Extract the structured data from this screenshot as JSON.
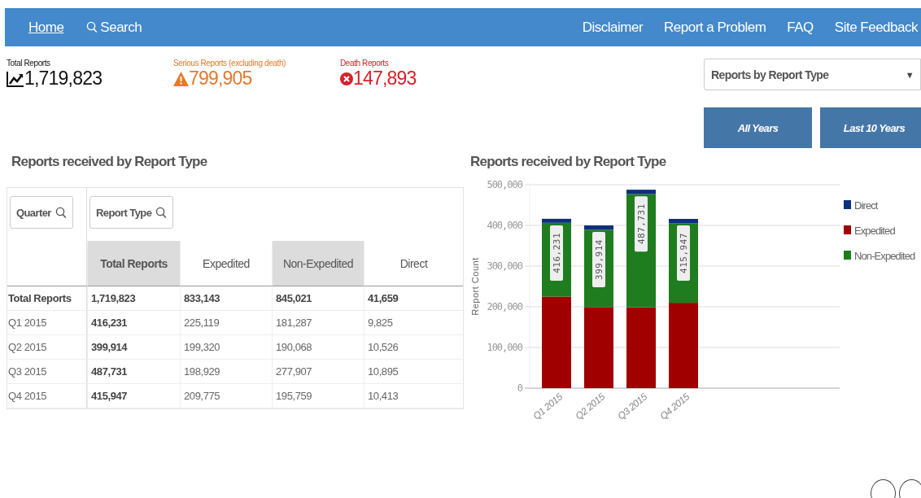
{
  "nav": {
    "left": [
      {
        "label": "Home",
        "kind": "link",
        "selected": true
      },
      {
        "label": "Search",
        "kind": "search",
        "selected": false
      }
    ],
    "right": [
      "Disclaimer",
      "Report a Problem",
      "FAQ",
      "Site Feedback"
    ]
  },
  "stats": [
    {
      "label": "Total Reports",
      "value": "1,719,823",
      "kind": "trend"
    },
    {
      "label": "Serious Reports (excluding death)",
      "value": "799,905",
      "kind": "warning"
    },
    {
      "label": "Death Reports",
      "value": "147,893",
      "kind": "death"
    }
  ],
  "report_select": {
    "value": "Reports by Report Type",
    "caret": "▼"
  },
  "year_buttons": [
    "All Years",
    "Last 10 Years"
  ],
  "table_section": {
    "title": "Reports received by Report Type",
    "filters": [
      "Quarter",
      "Report Type"
    ],
    "columns": [
      {
        "label": "Total Reports",
        "shaded": true
      },
      {
        "label": "Expedited",
        "shaded": false
      },
      {
        "label": "Non-Expedited",
        "shaded": true
      },
      {
        "label": "Direct",
        "shaded": false
      }
    ],
    "rows": [
      {
        "label": "Total Reports",
        "total": true,
        "cells": [
          "1,719,823",
          "833,143",
          "845,021",
          "41,659"
        ]
      },
      {
        "label": "Q1 2015",
        "total": false,
        "cells": [
          "416,231",
          "225,119",
          "181,287",
          "9,825"
        ]
      },
      {
        "label": "Q2 2015",
        "total": false,
        "cells": [
          "399,914",
          "199,320",
          "190,068",
          "10,526"
        ]
      },
      {
        "label": "Q3 2015",
        "total": false,
        "cells": [
          "487,731",
          "198,929",
          "277,907",
          "10,895"
        ]
      },
      {
        "label": "Q4 2015",
        "total": false,
        "cells": [
          "415,947",
          "209,775",
          "195,759",
          "10,413"
        ]
      }
    ]
  },
  "chart_section": {
    "title": "Reports received by Report Type",
    "chart_data": {
      "type": "bar",
      "stacked": true,
      "orientation": "vertical",
      "ylabel": "Report Count",
      "categories": [
        "Q1 2015",
        "Q2 2015",
        "Q3 2015",
        "Q4 2015"
      ],
      "series": [
        {
          "name": "Direct",
          "color": "#0d2f7f",
          "values": [
            9825,
            10526,
            10895,
            10413
          ]
        },
        {
          "name": "Expedited",
          "color": "#a00000",
          "values": [
            225119,
            199320,
            198929,
            209775
          ]
        },
        {
          "name": "Non-Expedited",
          "color": "#1f7d1f",
          "values": [
            181287,
            190068,
            277907,
            195759
          ]
        }
      ],
      "legend": true,
      "grid": true,
      "ylim": [
        0,
        500000
      ],
      "yticks": [
        {
          "value": 0,
          "label": "0"
        },
        {
          "value": 100000,
          "label": "100,000"
        },
        {
          "value": 200000,
          "label": "200,000"
        },
        {
          "value": 300000,
          "label": "300,000"
        },
        {
          "value": 400000,
          "label": "400,000"
        },
        {
          "value": 500000,
          "label": "500,000"
        }
      ],
      "value_labels": [
        "416,231",
        "399,914",
        "487,731",
        "415,947"
      ]
    }
  }
}
